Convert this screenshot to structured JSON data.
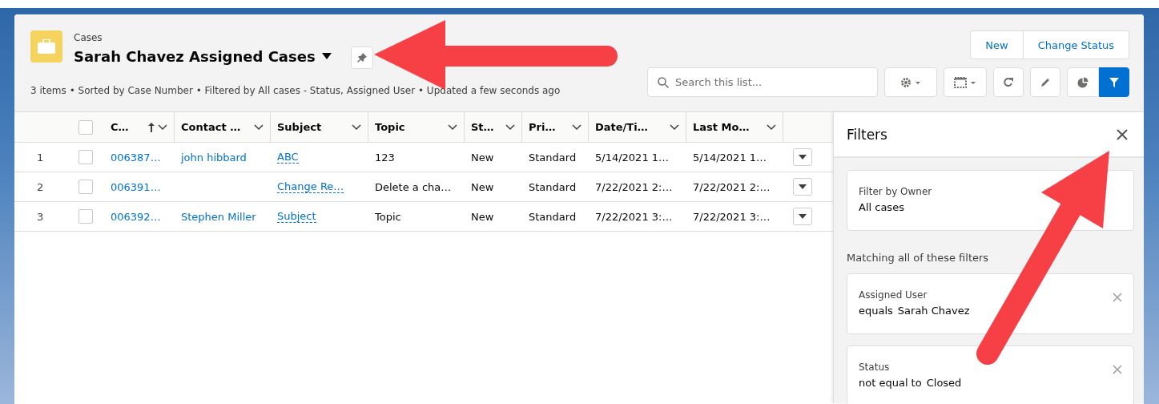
{
  "header": {
    "object_label": "Cases",
    "title": "Sarah Chavez Assigned Cases",
    "meta": "3 items • Sorted by Case Number • Filtered by All cases - Status, Assigned User • Updated a few seconds ago"
  },
  "actions": [
    "New",
    "Change Status"
  ],
  "search": {
    "placeholder": "Search this list..."
  },
  "toolbar": [
    {
      "kind": "settings",
      "selected": false
    },
    {
      "kind": "display",
      "selected": false
    },
    {
      "kind": "refresh",
      "selected": false
    },
    {
      "kind": "edit",
      "selected": false
    },
    {
      "kind": "chart",
      "selected": false
    },
    {
      "kind": "filter",
      "selected": true
    }
  ],
  "table": {
    "select_all_checked": false,
    "columns": [
      {
        "label": "C…",
        "sorted": true
      },
      {
        "label": "Contact …",
        "sorted": false
      },
      {
        "label": "Subject",
        "sorted": false
      },
      {
        "label": "Topic",
        "sorted": false
      },
      {
        "label": "St…",
        "sorted": false
      },
      {
        "label": "Pri…",
        "sorted": false
      },
      {
        "label": "Date/Ti…",
        "sorted": false
      },
      {
        "label": "Last Mo…",
        "sorted": false
      }
    ],
    "rows": [
      {
        "number": "1",
        "checked": false,
        "case_number": "006387…",
        "contact": "john hibbard",
        "subject": "ABC",
        "topic": "123",
        "status": "New",
        "priority": "Standard",
        "date_time": "5/14/2021 1…",
        "last_modified": "5/14/2021 1…"
      },
      {
        "number": "2",
        "checked": false,
        "case_number": "006391…",
        "subject": "Change Re…",
        "topic": "Delete a cha…",
        "status": "New",
        "priority": "Standard",
        "date_time": "7/22/2021 2:…",
        "last_modified": "7/22/2021 2:…"
      },
      {
        "number": "3",
        "checked": false,
        "case_number": "006392…",
        "contact": "Stephen Miller",
        "subject": "Subject",
        "topic": "Topic",
        "status": "New",
        "priority": "Standard",
        "date_time": "7/22/2021 3:…",
        "last_modified": "7/22/2021 3:…"
      }
    ]
  },
  "filters": {
    "title": "Filters",
    "owner": {
      "label": "Filter by Owner",
      "value": "All cases"
    },
    "matching_label": "Matching all of these filters",
    "items": [
      {
        "field": "Assigned User",
        "operator": "equals",
        "value": "Sarah Chavez"
      },
      {
        "field": "Status",
        "operator": "not equal to",
        "value": "Closed"
      }
    ]
  }
}
